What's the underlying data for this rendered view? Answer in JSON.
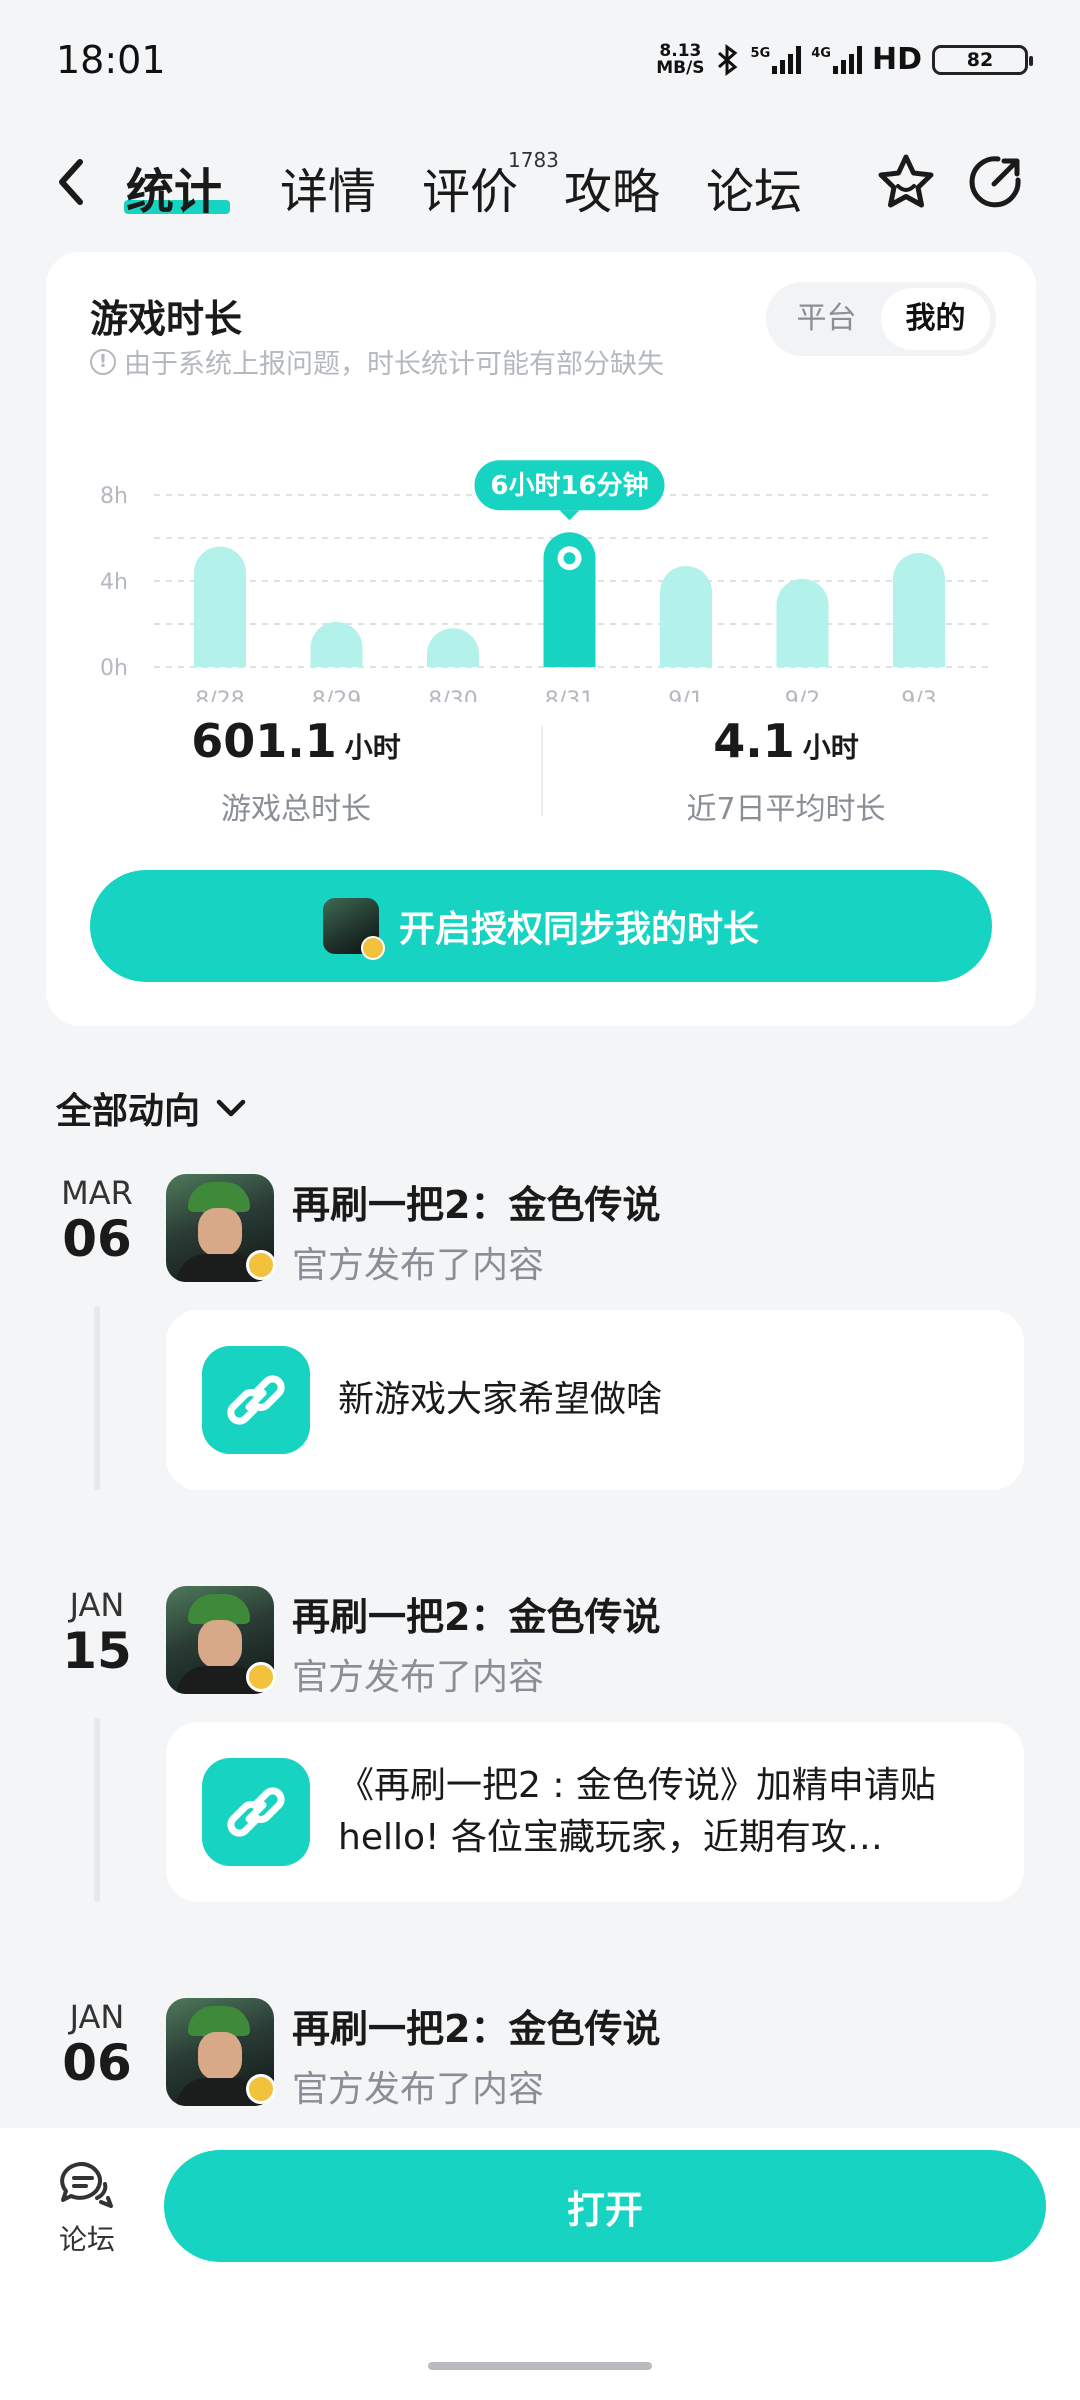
{
  "status_bar": {
    "time": "18:01",
    "speed_value": "8.13",
    "speed_unit": "MB/S",
    "net1": "5G",
    "net2": "4G",
    "hd": "HD",
    "battery": "82"
  },
  "nav": {
    "tabs": [
      {
        "label": "统计",
        "active": true
      },
      {
        "label": "详情",
        "active": false
      },
      {
        "label": "评价",
        "active": false
      },
      {
        "label": "攻略",
        "active": false
      },
      {
        "label": "论坛",
        "active": false
      }
    ],
    "review_count": "1783",
    "icons": [
      "back-arrow-icon",
      "star-favorite-icon",
      "share-icon"
    ]
  },
  "stats_card": {
    "title": "游戏时长",
    "note": "由于系统上报问题，时长统计可能有部分缺失",
    "toggle": {
      "options": [
        "平台",
        "我的"
      ],
      "selected": "我的"
    },
    "total_value": "601.1",
    "total_unit": "小时",
    "total_label": "游戏总时长",
    "avg_value": "4.1",
    "avg_unit": "小时",
    "avg_label": "近7日平均时长",
    "sync_button": "开启授权同步我的时长"
  },
  "chart_data": {
    "type": "bar",
    "categories": [
      "8/28",
      "8/29",
      "8/30",
      "8/31",
      "9/1",
      "9/2",
      "9/3"
    ],
    "values": [
      5.6,
      2.1,
      1.8,
      6.27,
      4.7,
      4.1,
      5.3
    ],
    "y_ticks": [
      "8h",
      "4h",
      "0h"
    ],
    "ylim": [
      0,
      8
    ],
    "highlight_index": 3,
    "highlight_label": "6小时16分钟",
    "colors": {
      "bar": "#b3f2ea",
      "highlight": "#17d4c2"
    }
  },
  "feed": {
    "header": "全部动向",
    "items": [
      {
        "month": "MAR",
        "day": "06",
        "title": "再刷一把2：金色传说",
        "subtitle": "官方发布了内容",
        "content": "新游戏大家希望做啥"
      },
      {
        "month": "JAN",
        "day": "15",
        "title": "再刷一把2：金色传说",
        "subtitle": "官方发布了内容",
        "content": "《再刷一把2 : 金色传说》加精申请贴 hello! 各位宝藏玩家，近期有攻…"
      },
      {
        "month": "JAN",
        "day": "06",
        "title": "再刷一把2：金色传说",
        "subtitle": "官方发布了内容"
      }
    ]
  },
  "bottom": {
    "forum_label": "论坛",
    "open_button": "打开"
  },
  "colors": {
    "accent": "#17d4c2",
    "background": "#f4f5f7"
  }
}
